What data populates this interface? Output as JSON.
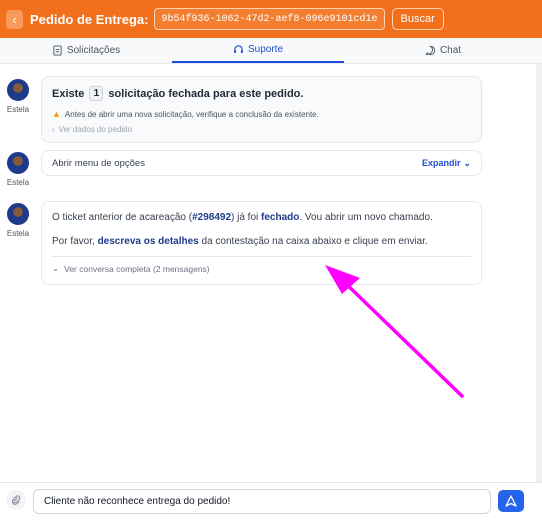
{
  "header": {
    "back_label": "‹",
    "title": "Pedido de Entrega:",
    "order_id": "9b54f936-1062-47d2-aef8-096e9101cd1e",
    "search_label": "Buscar"
  },
  "tabs": [
    {
      "label": "Solicitações",
      "icon": "document-icon"
    },
    {
      "label": "Suporte",
      "icon": "headset-icon"
    },
    {
      "label": "Chat",
      "icon": "chat-icon"
    }
  ],
  "messages": [
    {
      "author": "Estela",
      "prefix": "Existe",
      "count": "1",
      "suffix": "solicitação fechada para este pedido.",
      "warning": "Antes de abrir uma nova solicitação, verifique a conclusão da existente.",
      "toggle": "Ver dados do pedido"
    },
    {
      "author": "Estela",
      "text": "Abrir menu de opções",
      "action": "Expandir"
    },
    {
      "author": "Estela",
      "p1_a": "O ticket anterior de acareação (",
      "p1_ticket": "#298492",
      "p1_b": ") já foi ",
      "p1_status": "fechado",
      "p1_c": ". Vou abrir um novo chamado.",
      "p2_a": "Por favor, ",
      "p2_bold": "descreva os detalhes",
      "p2_b": " da contestação na caixa abaixo e clique em enviar.",
      "toggle": "Ver conversa completa (2 mensagens)"
    }
  ],
  "composer": {
    "value": "Cliente não reconhece entrega do pedido!",
    "send_icon": "send-icon"
  },
  "colors": {
    "brand": "#f2701c",
    "accent": "#1d4ed8",
    "annotation_arrow": "#ff00ff"
  }
}
